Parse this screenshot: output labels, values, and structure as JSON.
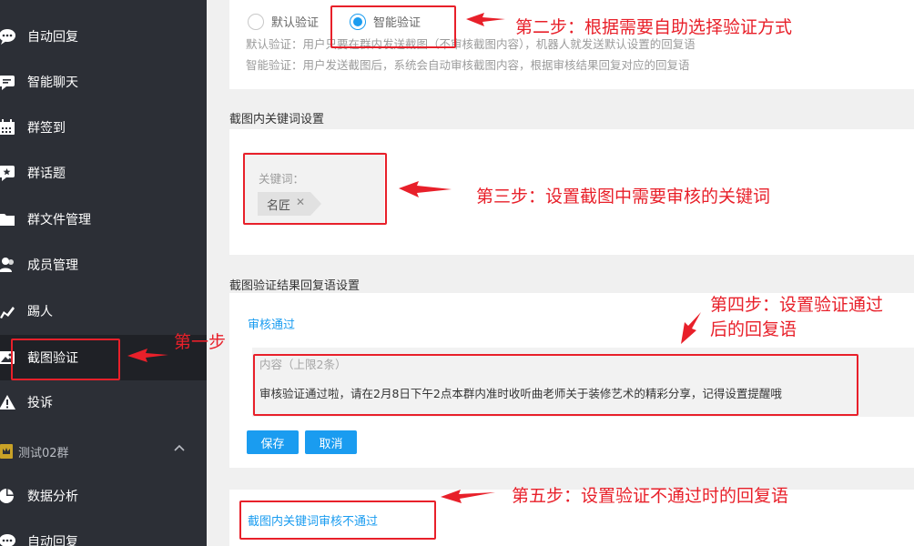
{
  "sidebar": {
    "items": [
      {
        "label": "自动回复",
        "icon": "chat-bubble-icon"
      },
      {
        "label": "智能聊天",
        "icon": "smart-chat-icon"
      },
      {
        "label": "群签到",
        "icon": "calendar-icon"
      },
      {
        "label": "群话题",
        "icon": "topic-star-icon"
      },
      {
        "label": "群文件管理",
        "icon": "folder-icon"
      },
      {
        "label": "成员管理",
        "icon": "members-icon"
      },
      {
        "label": "踢人",
        "icon": "kick-icon"
      },
      {
        "label": "截图验证",
        "icon": "screenshot-icon"
      },
      {
        "label": "投诉",
        "icon": "warning-icon"
      }
    ],
    "group": {
      "label": "测试02群",
      "icon": "crown-icon"
    },
    "group_items": [
      {
        "label": "数据分析",
        "icon": "pie-chart-icon"
      },
      {
        "label": "自动回复",
        "icon": "chat-bubble-icon"
      }
    ]
  },
  "verify": {
    "option_default": "默认验证",
    "option_smart": "智能验证",
    "desc_default": "默认验证：用户只要在群内发送截图（不审核截图内容），机器人就发送默认设置的回复语",
    "desc_smart": "智能验证：用户发送截图后，系统会自动审核截图内容，根据审核结果回复对应的回复语"
  },
  "keywords": {
    "section_title": "截图内关键词设置",
    "label": "关键词：",
    "tags": [
      "名匠"
    ]
  },
  "reply": {
    "section_title": "截图验证结果回复语设置",
    "pass_link": "审核通过",
    "content_placeholder": "内容（上限2条）",
    "content_text": "审核验证通过啦，请在2月8日下午2点本群内准时收听曲老师关于装修艺术的精彩分享，记得设置提醒哦",
    "save_label": "保存",
    "cancel_label": "取消",
    "fail_link": "截图内关键词审核不通过"
  },
  "annotations": {
    "step1": "第一步",
    "step2": "第二步：根据需要自助选择验证方式",
    "step3": "第三步：设置截图中需要审核的关键词",
    "step4_line1": "第四步：设置验证通过",
    "step4_line2": "后的回复语",
    "step5": "第五步：设置验证不通过时的回复语"
  },
  "colors": {
    "accent": "#1a9cf0",
    "annotation": "#e8202a",
    "sidebar": "#2c2f36"
  }
}
